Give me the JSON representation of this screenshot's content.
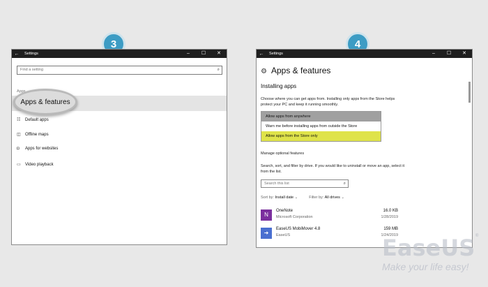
{
  "step_badges": [
    "3",
    "4"
  ],
  "left_window": {
    "title": "Settings",
    "back_glyph": "←",
    "controls": [
      "–",
      "☐",
      "✕"
    ],
    "search_placeholder": "Find a setting",
    "section_header": "Apps",
    "highlight_label": "Apps & features",
    "nav_items": [
      {
        "label": "Default apps",
        "icon": "default-apps-icon",
        "glyph": "☷"
      },
      {
        "label": "Offline maps",
        "icon": "map-icon",
        "glyph": "◫"
      },
      {
        "label": "Apps for websites",
        "icon": "website-icon",
        "glyph": "◘"
      },
      {
        "label": "Video playback",
        "icon": "video-icon",
        "glyph": "▭"
      }
    ]
  },
  "right_window": {
    "title": "Settings",
    "back_glyph": "←",
    "controls": [
      "–",
      "☐",
      "✕"
    ],
    "page_title": "Apps & features",
    "section_title": "Installing apps",
    "install_description": "Choose where you can get apps from. Installing only apps from the Store helps protect your PC and keep it running smoothly.",
    "dropdown_options": [
      "Allow apps from anywhere",
      "Warn me before installing apps from outside the Store",
      "Allow apps from the Store only"
    ],
    "manage_link": "Manage optional features",
    "filter_description": "Search, sort, and filter by drive. If you would like to uninstall or move an app, select it from the list.",
    "search_placeholder": "Search this list",
    "sort_label": "Sort by:",
    "sort_value": "Install date",
    "filter_label": "Filter by:",
    "filter_value": "All drives",
    "apps": [
      {
        "name": "OneNote",
        "publisher": "Microsoft Corporation",
        "size": "16.0 KB",
        "date": "1/28/2019",
        "color": "#7b2f9e",
        "glyph": "N"
      },
      {
        "name": "EaseUS MobiMover 4.8",
        "publisher": "EaseUS",
        "size": "159 MB",
        "date": "1/24/2019",
        "color": "#4a6fd0",
        "glyph": "➜"
      }
    ]
  },
  "watermark": {
    "brand": "EaseUS",
    "registered": "®",
    "tagline": "Make your life easy!"
  }
}
